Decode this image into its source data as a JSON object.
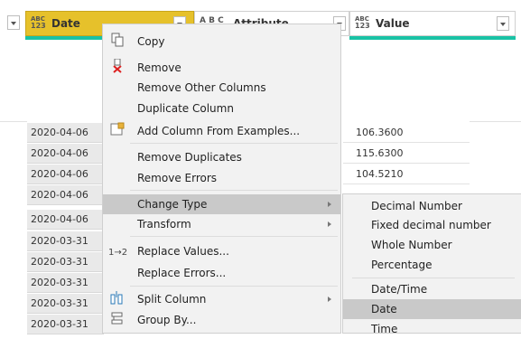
{
  "columns": [
    {
      "type_top": "ABC",
      "type_bottom": "123",
      "label": "Date"
    },
    {
      "type_icon": "A B C",
      "label": "Attribute"
    },
    {
      "type_top": "ABC",
      "type_bottom": "123",
      "label": "Value"
    }
  ],
  "dates": [
    "2020-04-06",
    "2020-04-06",
    "2020-04-06",
    "2020-04-06",
    "2020-04-06",
    "2020-03-31",
    "2020-03-31",
    "2020-03-31",
    "2020-03-31",
    "2020-03-31"
  ],
  "values": [
    "106.3600",
    "115.6300",
    "104.5210"
  ],
  "context_menu": {
    "items": [
      {
        "label": "Copy",
        "icon": "copy-icon"
      },
      {
        "label": "Remove",
        "icon": "remove-column-icon"
      },
      {
        "label": "Remove Other Columns"
      },
      {
        "label": "Duplicate Column"
      },
      {
        "label": "Add Column From Examples...",
        "icon": "add-column-examples-icon"
      },
      {
        "label": "Remove Duplicates"
      },
      {
        "label": "Remove Errors"
      },
      {
        "label": "Change Type",
        "submenu": true,
        "highlighted": true
      },
      {
        "label": "Transform",
        "submenu": true
      },
      {
        "label": "Replace Values...",
        "icon": "replace-values-icon",
        "icon_text": "1→2"
      },
      {
        "label": "Replace Errors..."
      },
      {
        "label": "Split Column",
        "submenu": true,
        "icon": "split-column-icon"
      },
      {
        "label": "Group By...",
        "icon": "group-by-icon"
      }
    ]
  },
  "submenu": {
    "items": [
      "Decimal Number",
      "Fixed decimal number",
      "Whole Number",
      "Percentage",
      "Date/Time",
      "Date",
      "Time"
    ],
    "highlighted": "Date"
  },
  "colors": {
    "selected_header": "#e6c12b",
    "quality_bar": "#19c2a5",
    "menu_bg": "#f2f2f2",
    "highlight": "#c9c9c9"
  }
}
